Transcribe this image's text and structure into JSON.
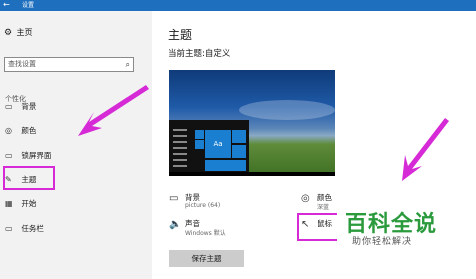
{
  "window": {
    "title": "设置"
  },
  "sidebar": {
    "home_label": "主页",
    "search_placeholder": "查找设置",
    "section_label": "个性化",
    "items": [
      {
        "label": "背景",
        "icon": "image-icon"
      },
      {
        "label": "颜色",
        "icon": "palette-icon"
      },
      {
        "label": "锁屏界面",
        "icon": "lockscreen-icon"
      },
      {
        "label": "主题",
        "icon": "brush-icon",
        "selected": true
      },
      {
        "label": "开始",
        "icon": "start-icon"
      },
      {
        "label": "任务栏",
        "icon": "taskbar-icon"
      }
    ]
  },
  "main": {
    "title": "主题",
    "current_theme": "当前主题:自定义",
    "preview": {
      "tile_label": "Aa"
    },
    "options": {
      "background": {
        "label": "背景",
        "sub": "picture (64)"
      },
      "sound": {
        "label": "声音",
        "sub": "Windows 默认"
      },
      "color": {
        "label": "颜色",
        "sub": "深蓝"
      },
      "mouse": {
        "label": "鼠标"
      }
    },
    "save_button": "保存主题"
  },
  "watermark": {
    "title": "百科全说",
    "subtitle": "助你轻松解决"
  },
  "colors": {
    "accent": "#1f6fbf",
    "highlight": "#d62ad6",
    "watermark": "#2a9a3c"
  }
}
